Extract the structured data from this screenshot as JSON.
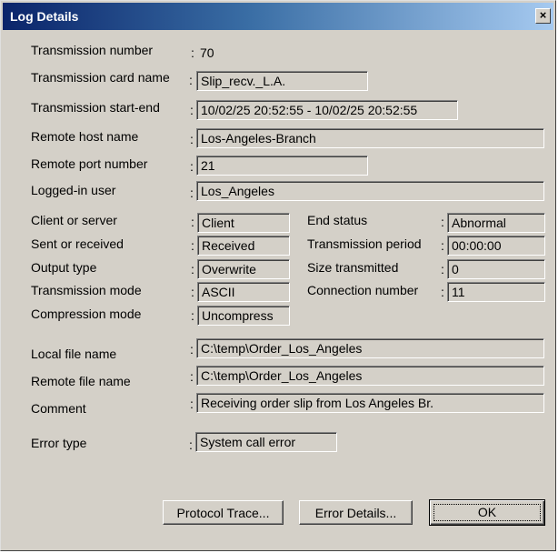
{
  "window": {
    "title": "Log Details",
    "close_label": "×"
  },
  "fields": {
    "transmission_number": {
      "label": "Transmission number",
      "value": "70"
    },
    "card_name": {
      "label": "Transmission card name",
      "value": "Slip_recv._L.A."
    },
    "start_end": {
      "label": "Transmission start-end",
      "value": "10/02/25 20:52:55  -  10/02/25 20:52:55"
    },
    "remote_host": {
      "label": "Remote host name",
      "value": "Los-Angeles-Branch"
    },
    "remote_port": {
      "label": "Remote port number",
      "value": "21"
    },
    "logged_user": {
      "label": "Logged-in user",
      "value": "Los_Angeles"
    },
    "client_server": {
      "label": "Client or server",
      "value": "Client"
    },
    "sent_received": {
      "label": "Sent or received",
      "value": "Received"
    },
    "output_type": {
      "label": "Output type",
      "value": "Overwrite"
    },
    "transmission_mode": {
      "label": "Transmission mode",
      "value": "ASCII"
    },
    "compression_mode": {
      "label": "Compression mode",
      "value": "Uncompress"
    },
    "end_status": {
      "label": "End status",
      "value": "Abnormal"
    },
    "transmission_period": {
      "label": "Transmission period",
      "value": "00:00:00"
    },
    "size_transmitted": {
      "label": "Size transmitted",
      "value": "0"
    },
    "connection_number": {
      "label": "Connection number",
      "value": "11"
    },
    "local_file": {
      "label": "Local file name",
      "value": "C:\\temp\\Order_Los_Angeles"
    },
    "remote_file": {
      "label": "Remote file name",
      "value": "C:\\temp\\Order_Los_Angeles"
    },
    "comment": {
      "label": "Comment",
      "value": "Receiving order slip from Los Angeles Br."
    },
    "error_type": {
      "label": "Error type",
      "value": "System call error"
    }
  },
  "separator": ":",
  "buttons": {
    "protocol_trace": "Protocol Trace...",
    "error_details": "Error Details...",
    "ok": "OK"
  }
}
